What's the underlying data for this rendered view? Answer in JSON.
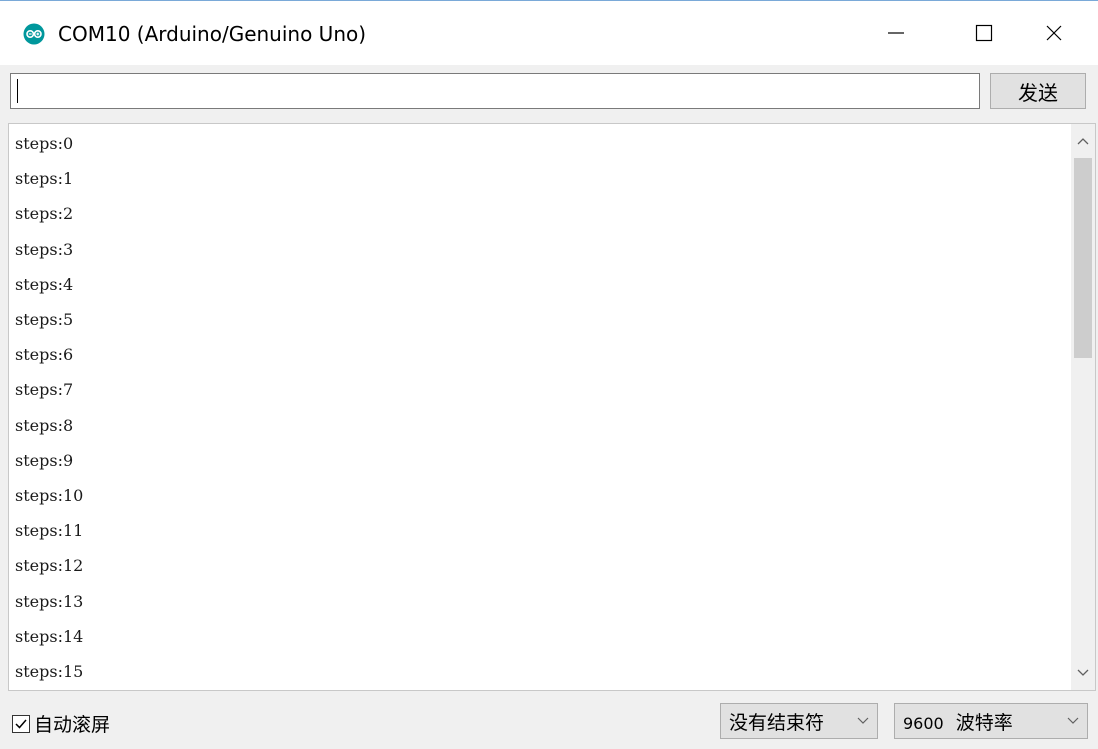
{
  "window": {
    "title": "COM10 (Arduino/Genuino Uno)",
    "accent_color": "#00979c",
    "icon": "arduino-logo-icon"
  },
  "controls": {
    "minimize_icon": "minimize-icon",
    "maximize_icon": "maximize-icon",
    "close_icon": "close-icon"
  },
  "send": {
    "input_value": "",
    "button_label": "发送"
  },
  "log": {
    "lines": [
      "steps:0",
      "steps:1",
      "steps:2",
      "steps:3",
      "steps:4",
      "steps:5",
      "steps:6",
      "steps:7",
      "steps:8",
      "steps:9",
      "steps:10",
      "steps:11",
      "steps:12",
      "steps:13",
      "steps:14",
      "steps:15"
    ]
  },
  "footer": {
    "autoscroll_label": "自动滚屏",
    "autoscroll_checked": true,
    "line_ending": "没有结束符",
    "baud_rate": "9600",
    "baud_suffix": "波特率"
  }
}
